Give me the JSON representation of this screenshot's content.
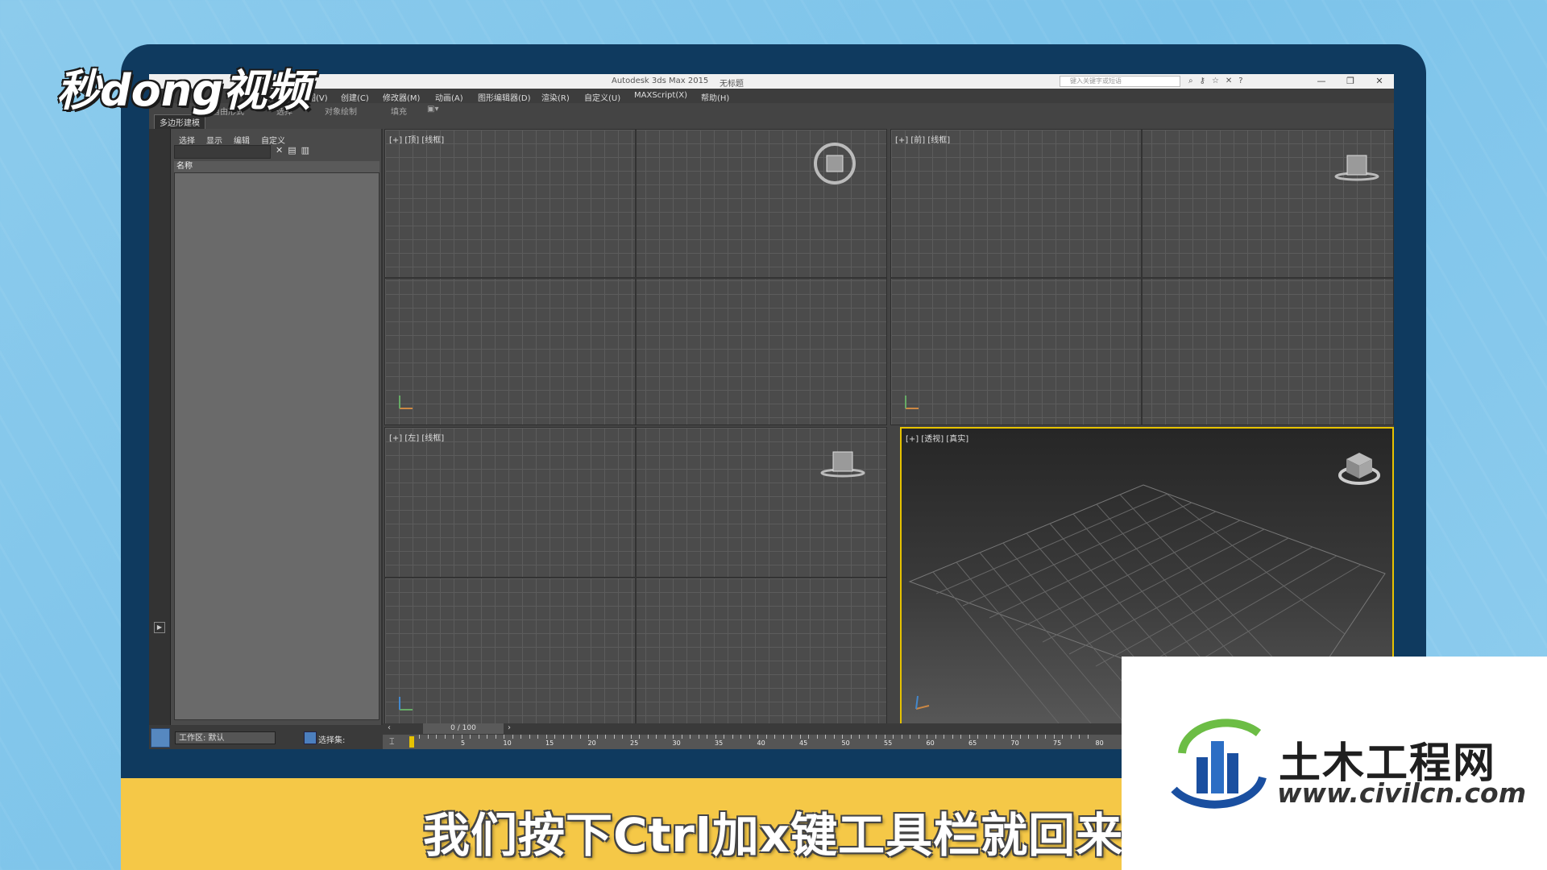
{
  "brand": {
    "logo_text": "秒dong视频"
  },
  "window": {
    "title": "Autodesk 3ds Max  2015",
    "document": "无标题",
    "search_placeholder": "键入关键字或短语",
    "controls": {
      "minimize": "—",
      "restore": "❐",
      "close": "✕"
    }
  },
  "menu": {
    "items": [
      "视图(V)",
      "创建(C)",
      "修改器(M)",
      "动画(A)",
      "图形编辑器(D)",
      "渲染(R)",
      "自定义(U)",
      "MAXScript(X)",
      "帮助(H)"
    ]
  },
  "ribbon": {
    "tabs": [
      "自由形式",
      "选择",
      "对象绘制",
      "填充"
    ],
    "subtab": "多边形建模"
  },
  "scene_explorer": {
    "tabs": [
      "选择",
      "显示",
      "编辑",
      "自定义"
    ],
    "column_header": "名称"
  },
  "viewports": {
    "top": "[+] [顶] [线框]",
    "front": "[+] [前] [线框]",
    "left": "[+] [左] [线框]",
    "perspective": "[+] [透视] [真实]"
  },
  "timeline": {
    "frame_label": "0 / 100",
    "ticks": [
      "5",
      "10",
      "15",
      "20",
      "25",
      "30",
      "35",
      "40",
      "45",
      "50",
      "55",
      "60",
      "65",
      "70",
      "75",
      "80"
    ]
  },
  "status": {
    "workspace": "工作区: 默认",
    "selection_set": "选择集:"
  },
  "subtitle": "我们按下Ctrl加x键工具栏就回来了",
  "watermark": {
    "cn": "土木工程网",
    "url": "www.civilcn.com"
  },
  "colors": {
    "accent_yellow": "#f5c847",
    "frame_navy": "#0f3a5f",
    "viewport_active": "#e6c200"
  }
}
